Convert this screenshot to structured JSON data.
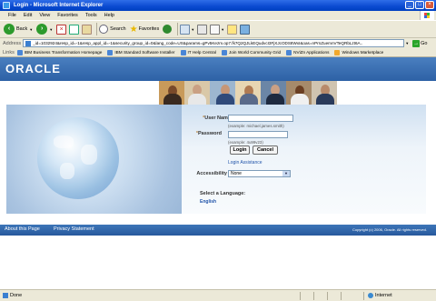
{
  "window": {
    "title": "Login - Microsoft Internet Explorer"
  },
  "menu": [
    "File",
    "Edit",
    "View",
    "Favorites",
    "Tools",
    "Help"
  ],
  "toolbar": {
    "back": "Back",
    "search": "Search",
    "favorites": "Favorites"
  },
  "address": {
    "label": "Address",
    "url": "_id=1032924&resp_id=-1&resp_appl_id=-1&security_group_id=0&lang_code=US&params=gPv5Kezm.op7.fk7Q2QJLkEQudvcI3FjXJcODS8WxI&oas=nPrnZuemnVTeQRbLzt6A..",
    "go": "Go"
  },
  "links": {
    "label": "Links",
    "items": [
      "IBM Business Transformation Homepage",
      "IBM Standard Software Installer",
      "IT Help Central",
      "Join World Community Grid",
      "NViZn Applications",
      "Windows Marketplace"
    ]
  },
  "page": {
    "brand": "ORACLE",
    "username_label": "User Name",
    "username_hint": "(example: michael.james.smith)",
    "password_label": "Password",
    "password_hint": "(example: 4u99v23)",
    "login_button": "Login",
    "cancel_button": "Cancel",
    "login_assistance": "Login Assistance",
    "accessibility_label": "Accessibility",
    "accessibility_value": "None",
    "language_label": "Select a Language:",
    "language_value": "English",
    "footer_about": "About this Page",
    "footer_privacy": "Privacy Statement",
    "copyright": "Copyright (c) 2006, Oracle. All rights reserved."
  },
  "status": {
    "text": "Done",
    "zone": "Internet"
  },
  "colors": {
    "oracle_blue": "#2d61a6",
    "xp_title": "#0a4ad0",
    "chrome": "#ece9d8"
  }
}
